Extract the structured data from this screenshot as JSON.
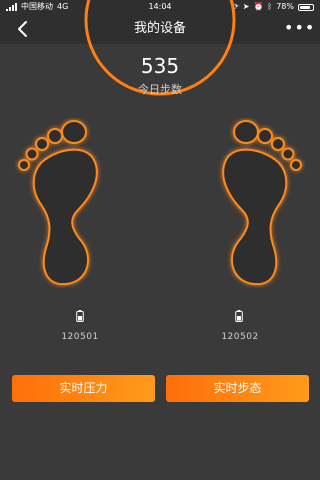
{
  "status_bar": {
    "carrier": "中国移动",
    "network": "4G",
    "time": "14:04",
    "battery_percent": "78%",
    "battery_level": 0.78
  },
  "nav": {
    "title": "我的设备",
    "more_label": "•••",
    "back_icon": "chevron-left-icon"
  },
  "steps": {
    "count": "535",
    "label": "今日步数"
  },
  "devices": [
    {
      "id": "120501",
      "side": "left",
      "battery_icon": "battery-icon"
    },
    {
      "id": "120502",
      "side": "right",
      "battery_icon": "battery-icon"
    }
  ],
  "buttons": {
    "pressure_label": "实时压力",
    "gait_label": "实时步态"
  },
  "colors": {
    "background": "#3a3a3a",
    "bar": "#2f2f2f",
    "accent": "#ff7f11",
    "foot_outline": "#ff8a1a"
  }
}
